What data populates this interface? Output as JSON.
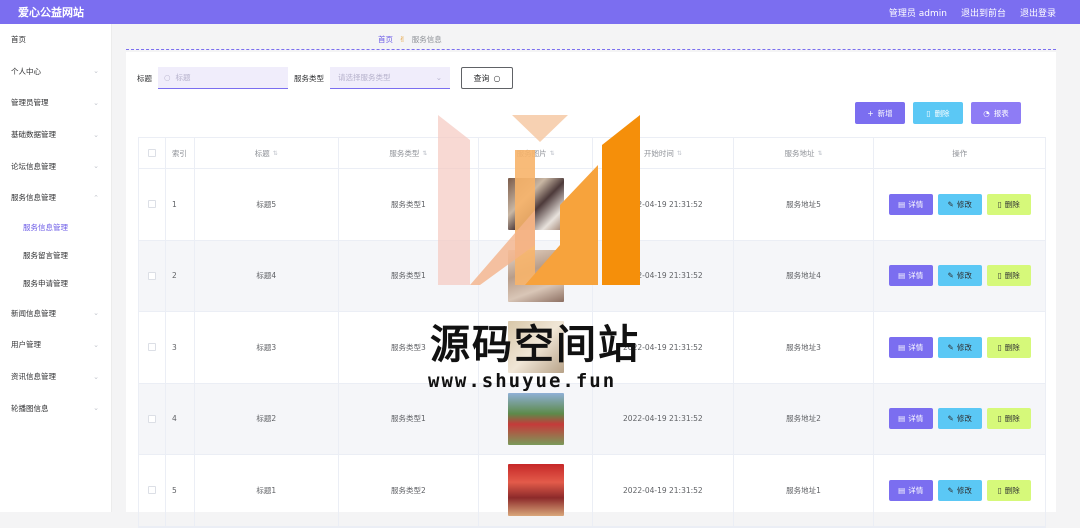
{
  "header": {
    "brand": "爱心公益网站",
    "user": "管理员 admin",
    "to_front": "退出到前台",
    "logout": "退出登录"
  },
  "sidebar": {
    "items": [
      {
        "label": "首页"
      },
      {
        "label": "个人中心"
      },
      {
        "label": "管理员管理"
      },
      {
        "label": "基础数据管理"
      },
      {
        "label": "论坛信息管理"
      },
      {
        "label": "服务信息管理"
      }
    ],
    "sub_items": [
      {
        "label": "服务信息管理"
      },
      {
        "label": "服务留言管理"
      },
      {
        "label": "服务申请管理"
      }
    ],
    "items_after": [
      {
        "label": "新闻信息管理"
      },
      {
        "label": "用户管理"
      },
      {
        "label": "资讯信息管理"
      },
      {
        "label": "轮播图信息"
      }
    ]
  },
  "breadcrumb": {
    "home": "首页",
    "current": "服务信息"
  },
  "search": {
    "title_label": "标题",
    "title_placeholder": "标题",
    "type_label": "服务类型",
    "type_placeholder": "请选择服务类型",
    "query_button": "查询"
  },
  "toolbar": {
    "add": "新增",
    "delete": "删除",
    "report": "报表"
  },
  "table": {
    "headers": [
      "索引",
      "标题",
      "服务类型",
      "服务图片",
      "开始时间",
      "服务地址",
      "操作"
    ],
    "rows": [
      {
        "index": "1",
        "title": "标题5",
        "type": "服务类型1",
        "time": "2022-04-19 21:31:52",
        "address": "服务地址5"
      },
      {
        "index": "2",
        "title": "标题4",
        "type": "服务类型1",
        "time": "2022-04-19 21:31:52",
        "address": "服务地址4"
      },
      {
        "index": "3",
        "title": "标题3",
        "type": "服务类型3",
        "time": "2022-04-19 21:31:52",
        "address": "服务地址3"
      },
      {
        "index": "4",
        "title": "标题2",
        "type": "服务类型1",
        "time": "2022-04-19 21:31:52",
        "address": "服务地址2"
      },
      {
        "index": "5",
        "title": "标题1",
        "type": "服务类型2",
        "time": "2022-04-19 21:31:52",
        "address": "服务地址1"
      }
    ],
    "op_labels": {
      "detail": "详情",
      "edit": "修改",
      "remove": "删除"
    }
  },
  "watermark": {
    "title": "源码空间站",
    "url": "www.shuyue.fun"
  },
  "colors": {
    "accent": "#7b6ef0",
    "info": "#5bc8f5",
    "lime": "#d6f97a"
  }
}
